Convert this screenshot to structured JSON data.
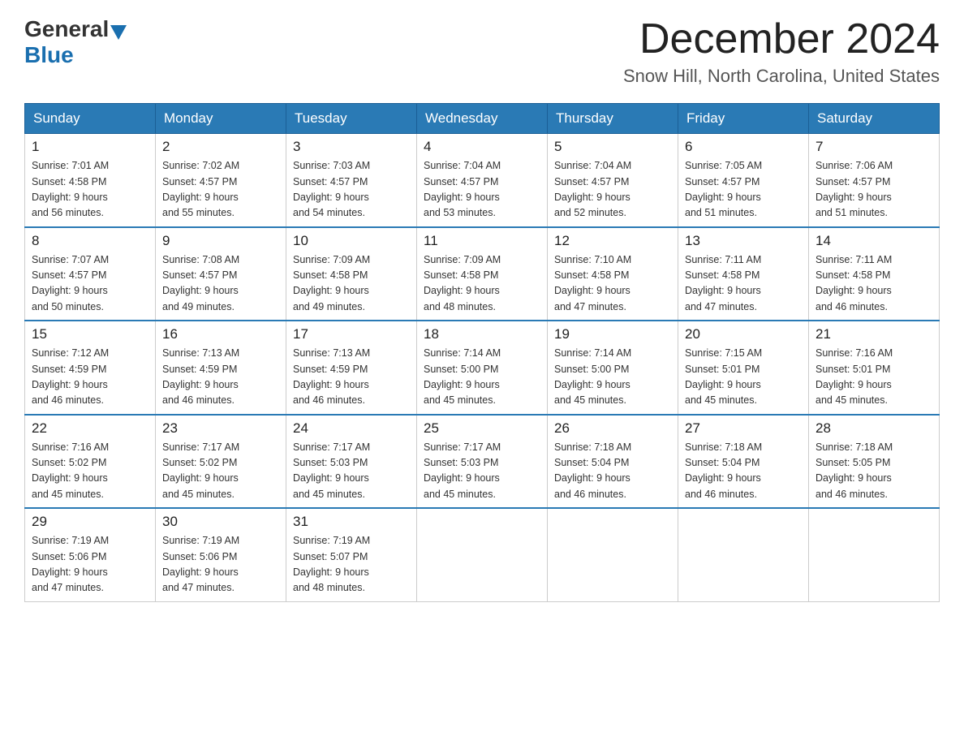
{
  "header": {
    "logo_general": "General",
    "logo_blue": "Blue",
    "month_title": "December 2024",
    "location": "Snow Hill, North Carolina, United States"
  },
  "weekdays": [
    "Sunday",
    "Monday",
    "Tuesday",
    "Wednesday",
    "Thursday",
    "Friday",
    "Saturday"
  ],
  "weeks": [
    [
      {
        "day": "1",
        "sunrise": "7:01 AM",
        "sunset": "4:58 PM",
        "daylight": "9 hours and 56 minutes."
      },
      {
        "day": "2",
        "sunrise": "7:02 AM",
        "sunset": "4:57 PM",
        "daylight": "9 hours and 55 minutes."
      },
      {
        "day": "3",
        "sunrise": "7:03 AM",
        "sunset": "4:57 PM",
        "daylight": "9 hours and 54 minutes."
      },
      {
        "day": "4",
        "sunrise": "7:04 AM",
        "sunset": "4:57 PM",
        "daylight": "9 hours and 53 minutes."
      },
      {
        "day": "5",
        "sunrise": "7:04 AM",
        "sunset": "4:57 PM",
        "daylight": "9 hours and 52 minutes."
      },
      {
        "day": "6",
        "sunrise": "7:05 AM",
        "sunset": "4:57 PM",
        "daylight": "9 hours and 51 minutes."
      },
      {
        "day": "7",
        "sunrise": "7:06 AM",
        "sunset": "4:57 PM",
        "daylight": "9 hours and 51 minutes."
      }
    ],
    [
      {
        "day": "8",
        "sunrise": "7:07 AM",
        "sunset": "4:57 PM",
        "daylight": "9 hours and 50 minutes."
      },
      {
        "day": "9",
        "sunrise": "7:08 AM",
        "sunset": "4:57 PM",
        "daylight": "9 hours and 49 minutes."
      },
      {
        "day": "10",
        "sunrise": "7:09 AM",
        "sunset": "4:58 PM",
        "daylight": "9 hours and 49 minutes."
      },
      {
        "day": "11",
        "sunrise": "7:09 AM",
        "sunset": "4:58 PM",
        "daylight": "9 hours and 48 minutes."
      },
      {
        "day": "12",
        "sunrise": "7:10 AM",
        "sunset": "4:58 PM",
        "daylight": "9 hours and 47 minutes."
      },
      {
        "day": "13",
        "sunrise": "7:11 AM",
        "sunset": "4:58 PM",
        "daylight": "9 hours and 47 minutes."
      },
      {
        "day": "14",
        "sunrise": "7:11 AM",
        "sunset": "4:58 PM",
        "daylight": "9 hours and 46 minutes."
      }
    ],
    [
      {
        "day": "15",
        "sunrise": "7:12 AM",
        "sunset": "4:59 PM",
        "daylight": "9 hours and 46 minutes."
      },
      {
        "day": "16",
        "sunrise": "7:13 AM",
        "sunset": "4:59 PM",
        "daylight": "9 hours and 46 minutes."
      },
      {
        "day": "17",
        "sunrise": "7:13 AM",
        "sunset": "4:59 PM",
        "daylight": "9 hours and 46 minutes."
      },
      {
        "day": "18",
        "sunrise": "7:14 AM",
        "sunset": "5:00 PM",
        "daylight": "9 hours and 45 minutes."
      },
      {
        "day": "19",
        "sunrise": "7:14 AM",
        "sunset": "5:00 PM",
        "daylight": "9 hours and 45 minutes."
      },
      {
        "day": "20",
        "sunrise": "7:15 AM",
        "sunset": "5:01 PM",
        "daylight": "9 hours and 45 minutes."
      },
      {
        "day": "21",
        "sunrise": "7:16 AM",
        "sunset": "5:01 PM",
        "daylight": "9 hours and 45 minutes."
      }
    ],
    [
      {
        "day": "22",
        "sunrise": "7:16 AM",
        "sunset": "5:02 PM",
        "daylight": "9 hours and 45 minutes."
      },
      {
        "day": "23",
        "sunrise": "7:17 AM",
        "sunset": "5:02 PM",
        "daylight": "9 hours and 45 minutes."
      },
      {
        "day": "24",
        "sunrise": "7:17 AM",
        "sunset": "5:03 PM",
        "daylight": "9 hours and 45 minutes."
      },
      {
        "day": "25",
        "sunrise": "7:17 AM",
        "sunset": "5:03 PM",
        "daylight": "9 hours and 45 minutes."
      },
      {
        "day": "26",
        "sunrise": "7:18 AM",
        "sunset": "5:04 PM",
        "daylight": "9 hours and 46 minutes."
      },
      {
        "day": "27",
        "sunrise": "7:18 AM",
        "sunset": "5:04 PM",
        "daylight": "9 hours and 46 minutes."
      },
      {
        "day": "28",
        "sunrise": "7:18 AM",
        "sunset": "5:05 PM",
        "daylight": "9 hours and 46 minutes."
      }
    ],
    [
      {
        "day": "29",
        "sunrise": "7:19 AM",
        "sunset": "5:06 PM",
        "daylight": "9 hours and 47 minutes."
      },
      {
        "day": "30",
        "sunrise": "7:19 AM",
        "sunset": "5:06 PM",
        "daylight": "9 hours and 47 minutes."
      },
      {
        "day": "31",
        "sunrise": "7:19 AM",
        "sunset": "5:07 PM",
        "daylight": "9 hours and 48 minutes."
      },
      null,
      null,
      null,
      null
    ]
  ],
  "labels": {
    "sunrise": "Sunrise: ",
    "sunset": "Sunset: ",
    "daylight": "Daylight: "
  }
}
